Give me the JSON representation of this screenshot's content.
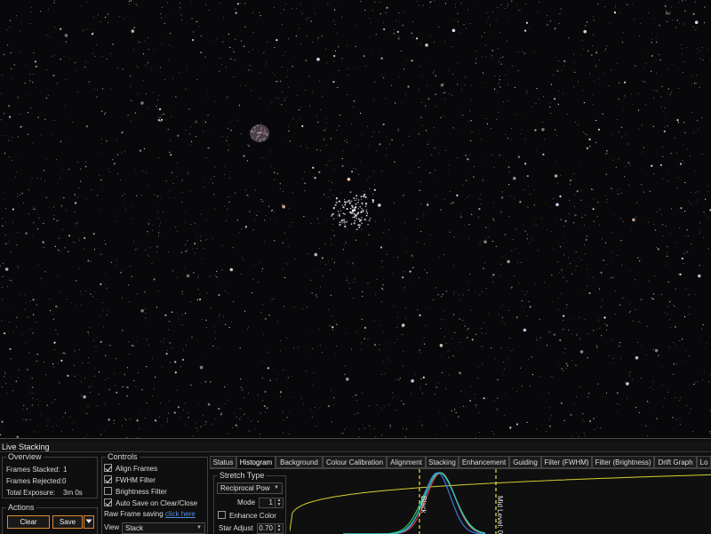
{
  "panel": {
    "title": "Live Stacking"
  },
  "overview": {
    "title": "Overview",
    "frames_stacked_label": "Frames Stacked:",
    "frames_stacked_value": "1",
    "frames_rejected_label": "Frames Rejected:",
    "frames_rejected_value": "0",
    "total_exposure_label": "Total Exposure:",
    "total_exposure_value": "3m 0s"
  },
  "actions": {
    "title": "Actions",
    "clear_label": "Clear",
    "save_label": "Save",
    "save_dropdown_icon": "chevron-down-icon"
  },
  "controls": {
    "title": "Controls",
    "align_frames": {
      "label": "Align Frames",
      "checked": true
    },
    "fwhm_filter": {
      "label": "FWHM Filter",
      "checked": true
    },
    "brightness_filter": {
      "label": "Brightness Filter",
      "checked": false
    },
    "auto_save": {
      "label": "Auto Save on Clear/Close",
      "checked": true
    },
    "raw_frame_saving_label": "Raw Frame saving",
    "raw_frame_saving_link": "click here",
    "view_label": "View",
    "view_value": "Stack"
  },
  "tabs": [
    {
      "label": "Status",
      "active": false
    },
    {
      "label": "Histogram",
      "active": true
    },
    {
      "label": "Background",
      "active": false
    },
    {
      "label": "Colour Calibration",
      "active": false
    },
    {
      "label": "Alignment",
      "active": false
    },
    {
      "label": "Stacking",
      "active": false
    },
    {
      "label": "Enhancement",
      "active": false
    },
    {
      "label": "Guiding",
      "active": false
    },
    {
      "label": "Filter (FWHM)",
      "active": false
    },
    {
      "label": "Filter (Brightness)",
      "active": false
    },
    {
      "label": "Drift Graph",
      "active": false
    },
    {
      "label": "Lo",
      "active": false
    }
  ],
  "histogram": {
    "stretch_type_title": "Stretch Type",
    "stretch_type_value": "Reciprocal Pow",
    "mode_label": "Mode",
    "mode_value": "1",
    "enhance_color_label": "Enhance Color",
    "enhance_color_checked": false,
    "star_adjust_label": "Star Adjust",
    "star_adjust_value": "0.70",
    "marker_labels": [
      "Black",
      "Mid Level: 0.0"
    ],
    "colors": {
      "red": "#e04040",
      "green": "#38c060",
      "blue": "#3a78e0",
      "cyan": "#30c8c8",
      "curve": "#d8d030",
      "marker": "#e8e040"
    }
  }
}
